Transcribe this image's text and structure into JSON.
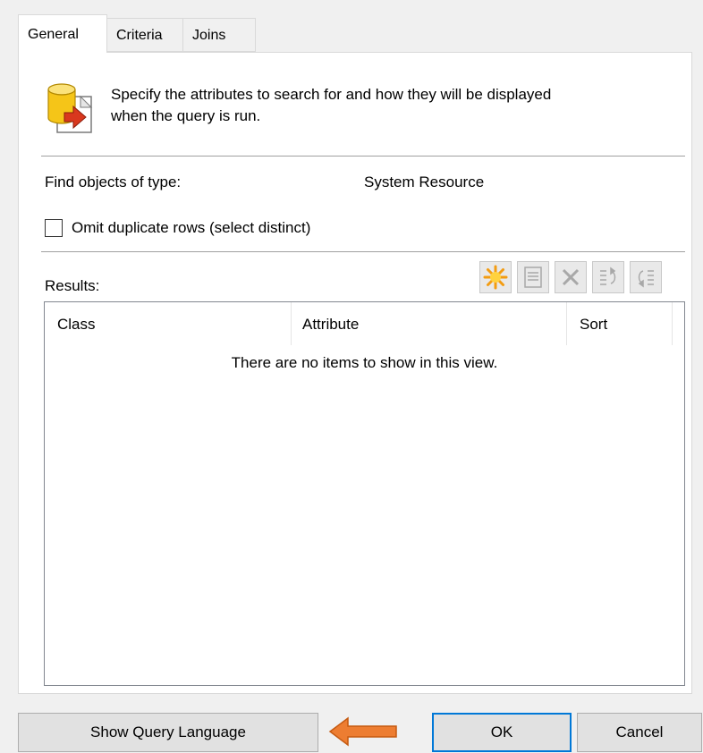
{
  "tabs": [
    {
      "label": "General",
      "active": true
    },
    {
      "label": "Criteria",
      "active": false
    },
    {
      "label": "Joins",
      "active": false
    }
  ],
  "header": {
    "line1": "Specify the attributes to search for and how they will be displayed",
    "line2": "when the query is run.",
    "icon": "database-query-icon"
  },
  "find_objects": {
    "label": "Find objects of type:",
    "value": "System Resource"
  },
  "omit_duplicates": {
    "label": "Omit duplicate rows (select distinct)",
    "checked": false
  },
  "results": {
    "label": "Results:",
    "toolbar": [
      {
        "name": "new-icon",
        "enabled": true
      },
      {
        "name": "properties-icon",
        "enabled": false
      },
      {
        "name": "delete-icon",
        "enabled": false
      },
      {
        "name": "move-up-icon",
        "enabled": false
      },
      {
        "name": "move-down-icon",
        "enabled": false
      }
    ],
    "columns": [
      "Class",
      "Attribute",
      "Sort"
    ],
    "empty_text": "There are no items to show in this view."
  },
  "buttons": {
    "show_query": "Show Query Language",
    "ok": "OK",
    "cancel": "Cancel"
  },
  "colors": {
    "accent": "#0078d7",
    "arrow": "#ed7d31",
    "icon_yellow": "#f5c518",
    "icon_red": "#d9381e"
  }
}
